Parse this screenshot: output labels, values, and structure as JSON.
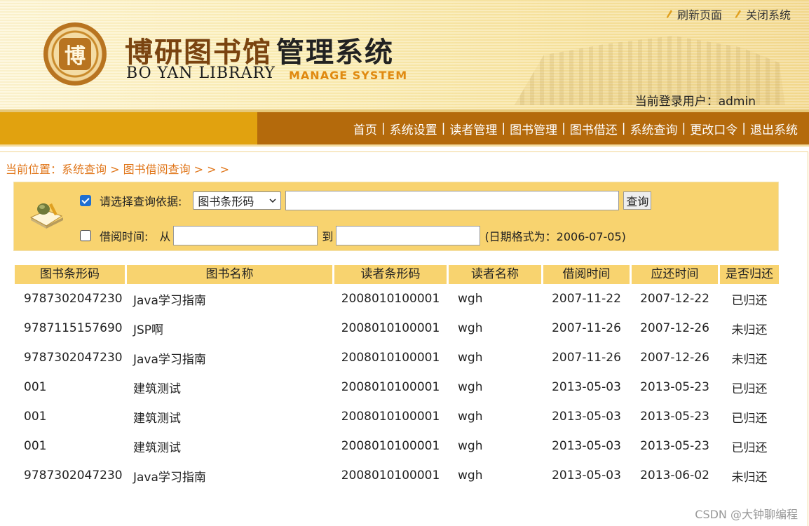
{
  "header": {
    "logo_title_cn": "博研图书馆",
    "logo_title_cn_suffix": "管理系统",
    "logo_title_en": "BO YAN LIBRARY",
    "logo_title_en_suffix": "MANAGE SYSTEM",
    "logo_seal_char": "博",
    "top_links": [
      "刷新页面",
      "关闭系统"
    ],
    "login_user": "当前登录用户：admin"
  },
  "nav": {
    "items": [
      "首页",
      "系统设置",
      "读者管理",
      "图书管理",
      "图书借还",
      "系统查询",
      "更改口令",
      "退出系统"
    ],
    "separator": "|"
  },
  "breadcrumb": "当前位置：系统查询 > 图书借阅查询 > > >",
  "query": {
    "basis_checked": true,
    "basis_label": "请选择查询依据:",
    "basis_select_value": "图书条形码",
    "keyword_value": "",
    "search_button": "查询",
    "time_checked": false,
    "time_label": "借阅时间:",
    "from_label": "从",
    "from_value": "",
    "to_label": "到",
    "to_value": "",
    "date_hint": "(日期格式为：2006-07-05)"
  },
  "table": {
    "columns": [
      "图书条形码",
      "图书名称",
      "读者条形码",
      "读者名称",
      "借阅时间",
      "应还时间",
      "是否归还"
    ],
    "rows": [
      [
        "9787302047230",
        "Java学习指南",
        "2008010100001",
        "wgh",
        "2007-11-22",
        "2007-12-22",
        "已归还"
      ],
      [
        "9787115157690",
        "JSP啊",
        "2008010100001",
        "wgh",
        "2007-11-26",
        "2007-12-26",
        "未归还"
      ],
      [
        "9787302047230",
        "Java学习指南",
        "2008010100001",
        "wgh",
        "2007-11-26",
        "2007-12-26",
        "未归还"
      ],
      [
        "001",
        "建筑测试",
        "2008010100001",
        "wgh",
        "2013-05-03",
        "2013-05-23",
        "已归还"
      ],
      [
        "001",
        "建筑测试",
        "2008010100001",
        "wgh",
        "2013-05-03",
        "2013-05-23",
        "已归还"
      ],
      [
        "001",
        "建筑测试",
        "2008010100001",
        "wgh",
        "2013-05-03",
        "2013-05-23",
        "已归还"
      ],
      [
        "9787302047230",
        "Java学习指南",
        "2008010100001",
        "wgh",
        "2013-05-03",
        "2013-06-02",
        "未归还"
      ]
    ]
  },
  "watermark": "CSDN @大钟聊编程",
  "colors": {
    "nav_left": "#e1a20f",
    "nav_right": "#b46a0c",
    "panel": "#f8d36f",
    "breadcrumb": "#e0761a",
    "checkbox_checked": "#1f6fd1"
  }
}
